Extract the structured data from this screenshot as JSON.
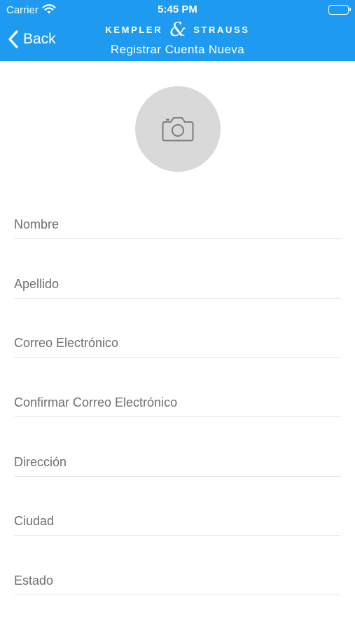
{
  "status_bar": {
    "carrier": "Carrier",
    "time": "5:45 PM"
  },
  "nav": {
    "back_label": "Back",
    "brand_left": "KEMPLER",
    "brand_amp": "&",
    "brand_right": "STRAUSS",
    "subtitle": "Registrar Cuenta Nueva"
  },
  "colors": {
    "header": "#1e9bf0",
    "photo_placeholder": "#d9d9d9",
    "divider": "#e6e6e6"
  },
  "photo": {
    "icon": "camera-icon"
  },
  "form": {
    "fields": [
      {
        "placeholder": "Nombre",
        "value": ""
      },
      {
        "placeholder": "Apellido",
        "value": ""
      },
      {
        "placeholder": "Correo Electrónico",
        "value": ""
      },
      {
        "placeholder": "Confirmar Correo Electrónico",
        "value": ""
      },
      {
        "placeholder": "Dirección",
        "value": ""
      },
      {
        "placeholder": "Ciudad",
        "value": ""
      },
      {
        "placeholder": "Estado",
        "value": ""
      }
    ]
  }
}
